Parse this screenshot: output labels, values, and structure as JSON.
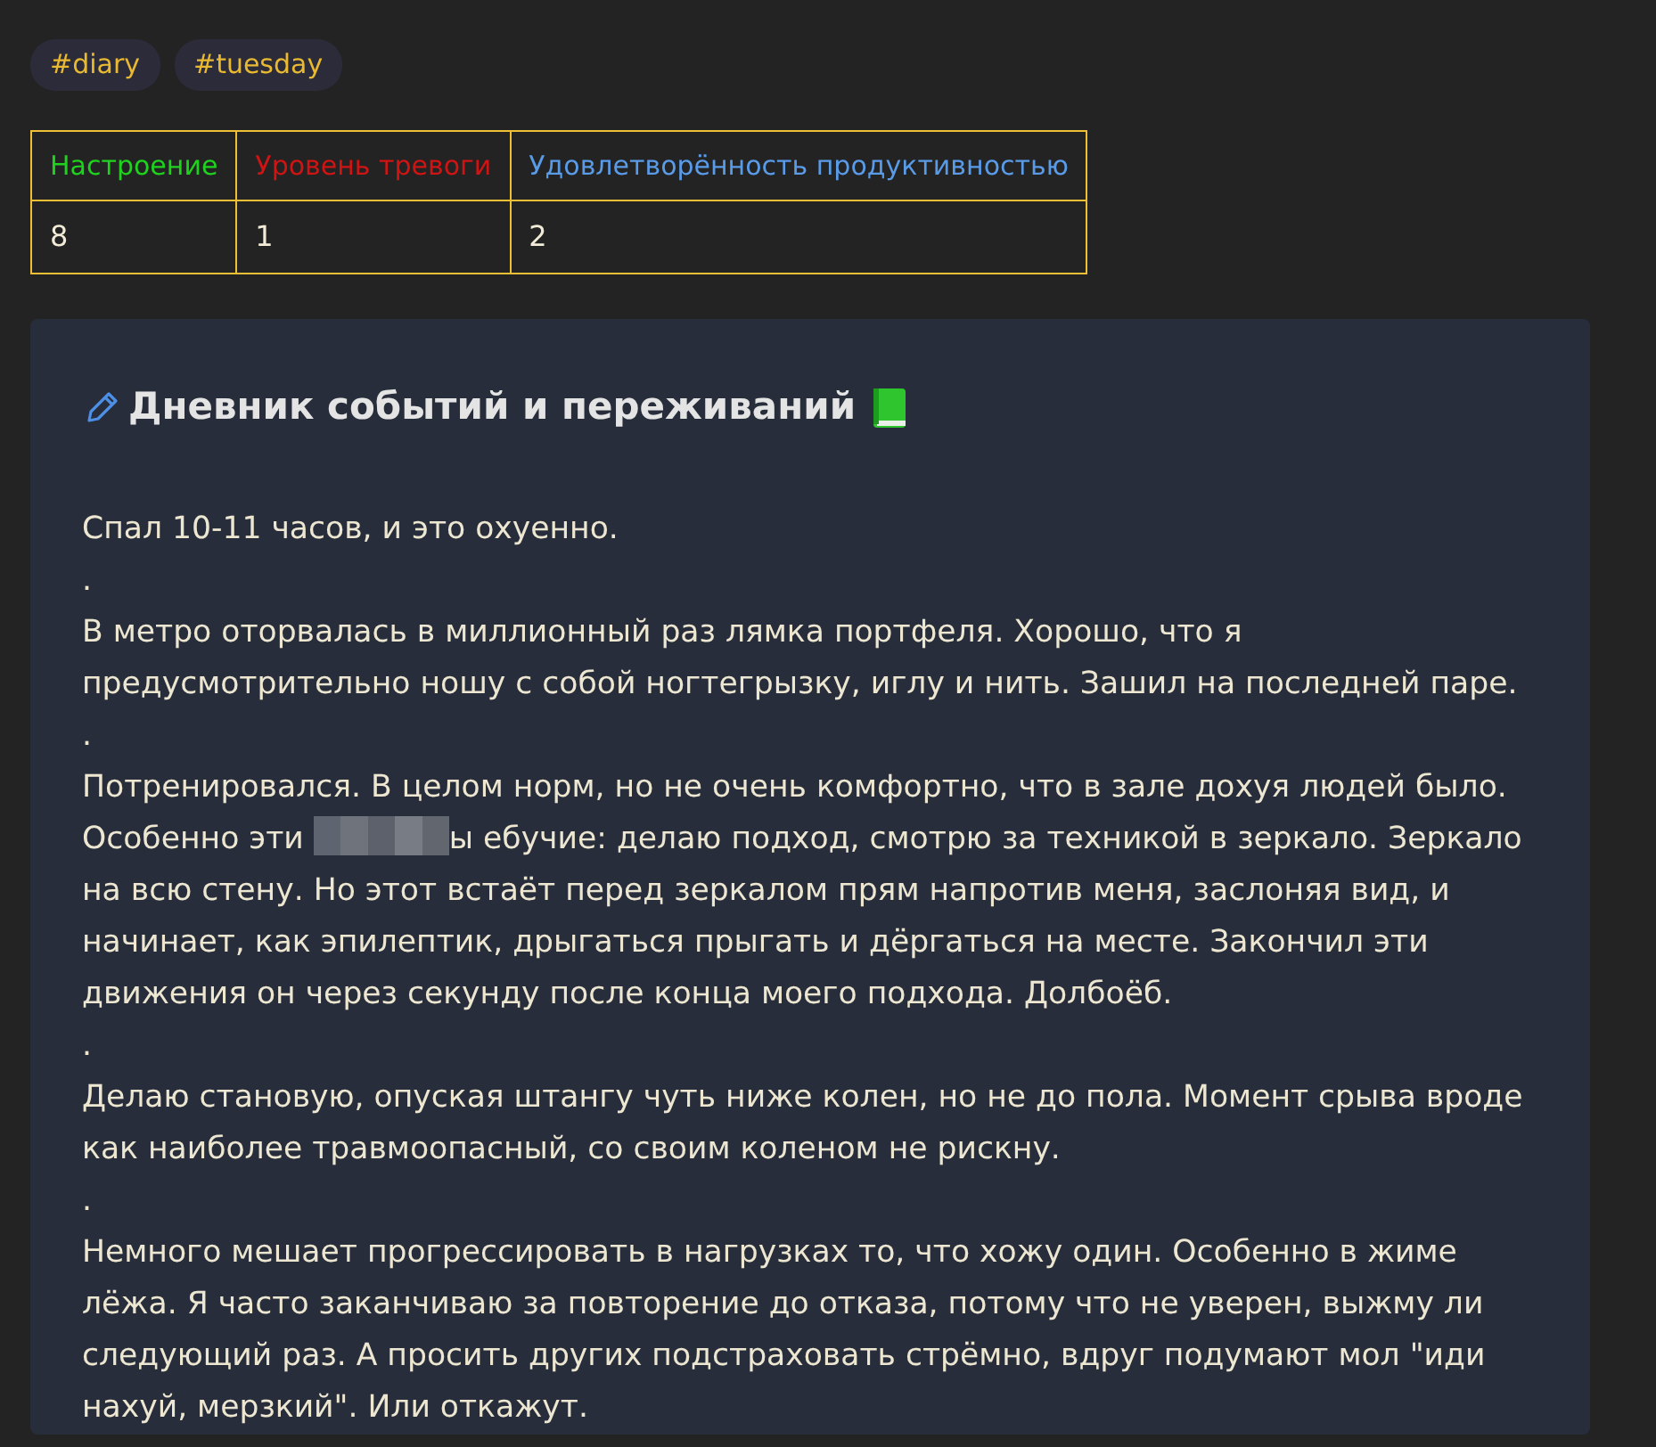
{
  "tags": [
    {
      "label": "#diary"
    },
    {
      "label": "#tuesday"
    }
  ],
  "table": {
    "columns": [
      {
        "label": "Настроение",
        "color": "#1ed21e"
      },
      {
        "label": "Уровень тревоги",
        "color": "#d01414"
      },
      {
        "label": "Удовлетворённость продуктивностью",
        "color": "#5a9be8"
      }
    ],
    "rows": [
      [
        "8",
        "1",
        "2"
      ]
    ]
  },
  "callout": {
    "title": "Дневник событий и переживаний",
    "paragraphs": [
      {
        "kind": "text",
        "text": "Спал 10-11 часов, и это охуенно."
      },
      {
        "kind": "text",
        "text": "."
      },
      {
        "kind": "text",
        "text": "В метро оторвалась в миллионный раз лямка портфеля. Хорошо, что я предусмотрительно ношу с собой ногтегрызку, иглу и нить. Зашил на последней паре."
      },
      {
        "kind": "text",
        "text": "."
      },
      {
        "kind": "redacted",
        "before": "Потренировался. В целом норм, но не очень комфортно, что в зале дохуя людей было. Особенно эти",
        "after": "ы ебучие: делаю подход, смотрю за техникой в зеркало. Зеркало на всю стену. Но этот встаёт перед зеркалом прям напротив меня, заслоняя вид, и начинает, как эпилептик, дрыгаться прыгать и дёргаться на месте. Закончил эти движения он через секунду после конца моего подхода. Долбоёб."
      },
      {
        "kind": "text",
        "text": "."
      },
      {
        "kind": "text",
        "text": "Делаю становую, опуская штангу чуть ниже колен, но не до пола. Момент срыва вроде как наиболее травмоопасный, со своим коленом не рискну."
      },
      {
        "kind": "text",
        "text": "."
      },
      {
        "kind": "text",
        "text": "Немного мешает прогрессировать в нагрузках то, что хожу один. Особенно в жиме лёжа. Я часто заканчиваю за повторение до отказа, потому что не уверен, выжму ли следующий раз. А просить других подстраховать стрёмно, вдруг подумают мол \"иди нахуй, мерзкий\". Или откажут."
      }
    ]
  }
}
